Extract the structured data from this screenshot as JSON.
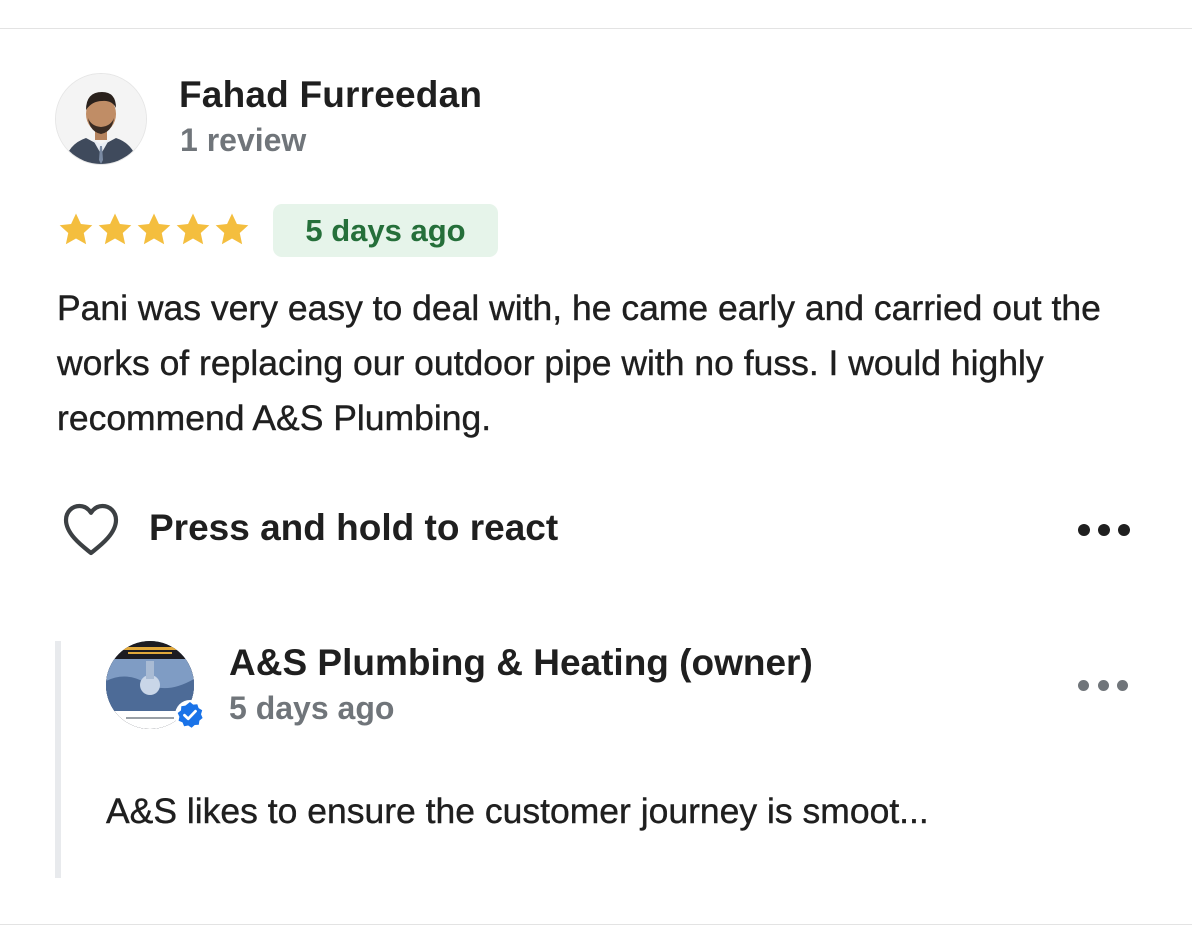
{
  "reviewer": {
    "name": "Fahad Furreedan",
    "review_count": "1 review",
    "avatar_icon": "person-photo"
  },
  "review": {
    "rating": 5,
    "rating_max": 5,
    "date": "5 days ago",
    "text": "Pani was very easy to deal with, he came early and carried out the works of replacing our outdoor pipe with no fuss. I would highly recommend A&S Plumbing."
  },
  "actions": {
    "react_label": "Press and hold to react",
    "react_icon": "heart-outline-icon",
    "more_icon": "more-horizontal-icon"
  },
  "owner_reply": {
    "name": "A&S Plumbing & Heating (owner)",
    "date": "5 days ago",
    "text": "A&S likes to ensure the customer journey is smoot...",
    "verified_icon": "verified-badge-icon",
    "more_icon": "more-horizontal-icon"
  },
  "colors": {
    "star": "#f4be3e",
    "badge_bg": "#e6f4ea",
    "badge_text": "#256f3a",
    "secondary_text": "#70757a",
    "verified_blue": "#1a73e8",
    "rail": "#e8eaed"
  }
}
